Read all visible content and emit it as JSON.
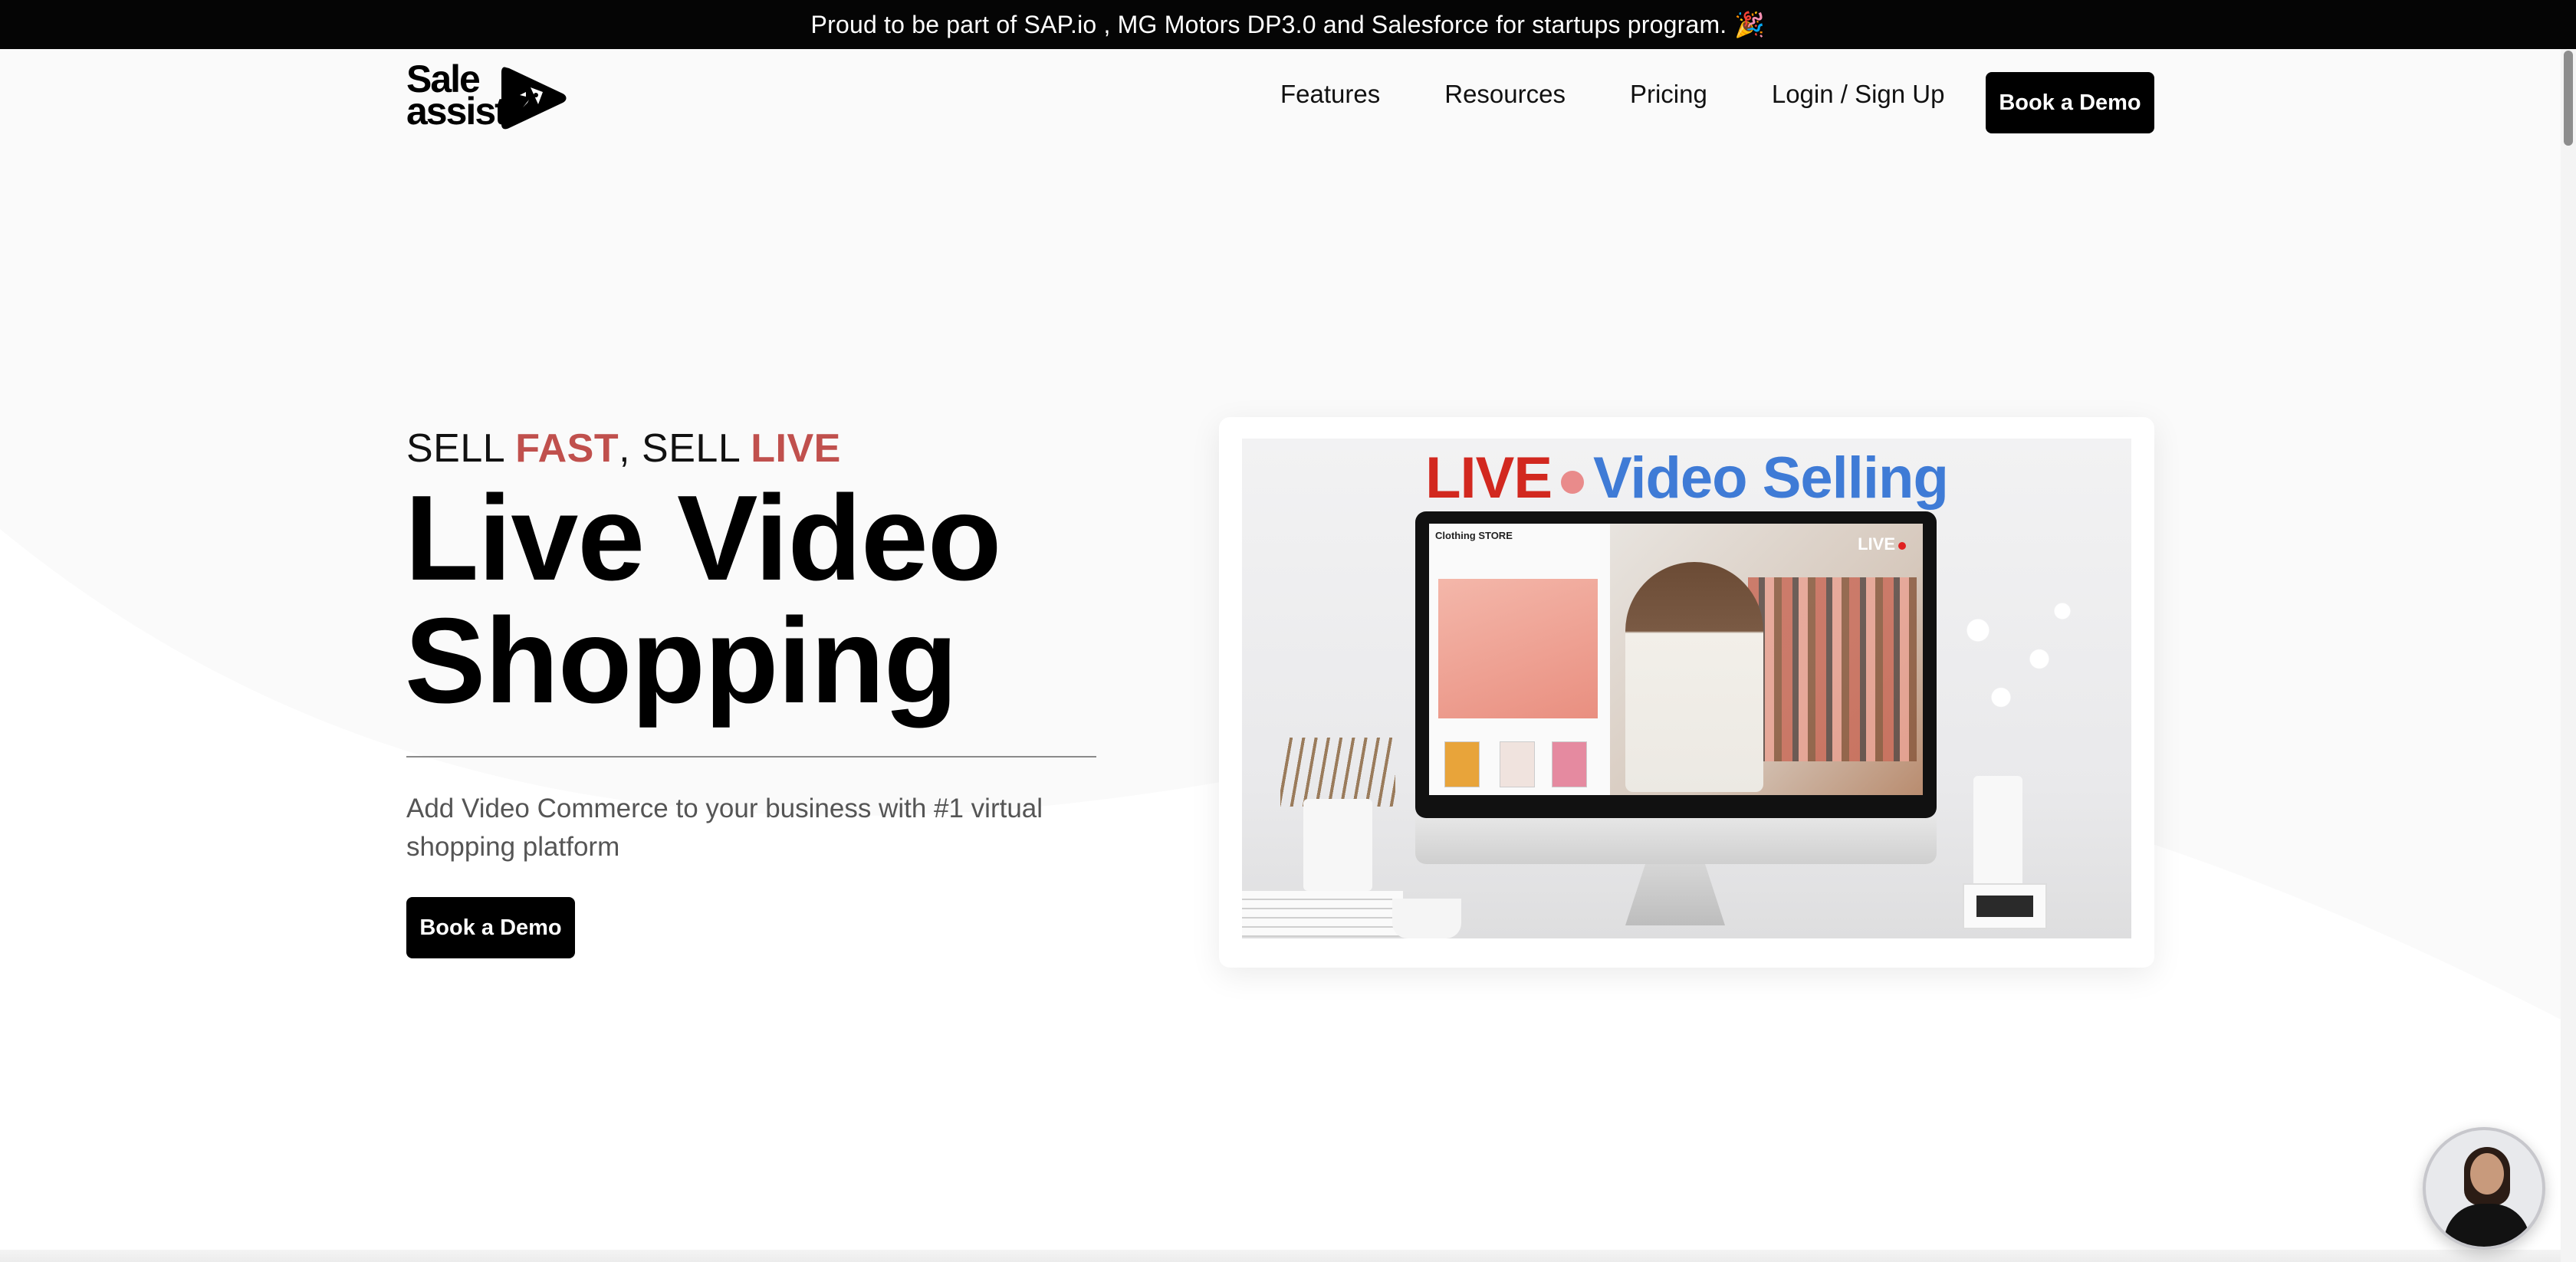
{
  "announcement": {
    "text": "Proud to be part of SAP.io , MG Motors DP3.0 and Salesforce for startups program.",
    "emoji": "🎉"
  },
  "brand": {
    "logo_line1": "Sale",
    "logo_line2": "assist",
    "icon": "rocket-play-icon"
  },
  "nav": {
    "items": [
      {
        "label": "Features"
      },
      {
        "label": "Resources"
      },
      {
        "label": "Pricing"
      },
      {
        "label": "Login / Sign Up"
      }
    ],
    "cta_label": "Book a Demo"
  },
  "hero": {
    "eyebrow_part1": "SELL ",
    "eyebrow_accent1": "FAST",
    "eyebrow_part2": ", SELL ",
    "eyebrow_accent2": "LIVE",
    "title_line1": "Live Video",
    "title_line2": "Shopping",
    "subtitle": "Add Video Commerce to your business with #1 virtual shopping platform",
    "cta_label": "Book a Demo"
  },
  "media": {
    "title_live": "LIVE",
    "title_rest": "Video Selling",
    "shop_name": "Clothing STORE",
    "live_badge": "LIVE"
  },
  "colors": {
    "accent_red": "#c0504d",
    "live_red": "#d2281f",
    "video_blue": "#3f7bd6",
    "button_bg": "#000000"
  },
  "chat_widget": {
    "icon": "video-assistant-avatar"
  }
}
